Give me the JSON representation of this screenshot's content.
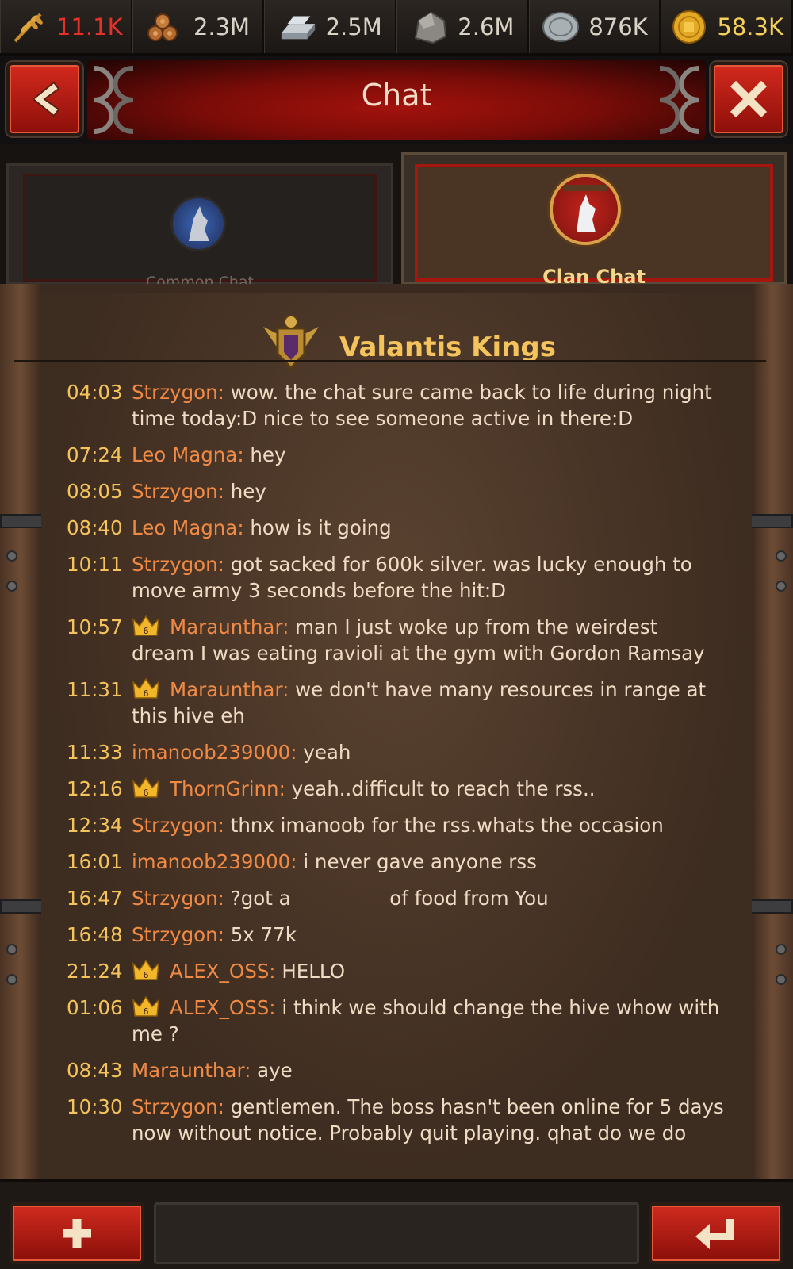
{
  "resources": [
    {
      "name": "food",
      "value": "11.1K",
      "icon": "wheat-icon",
      "color": "#e8302a"
    },
    {
      "name": "wood",
      "value": "2.3M",
      "icon": "logs-icon",
      "color": "#d9d2c6"
    },
    {
      "name": "iron",
      "value": "2.5M",
      "icon": "iron-ingot-icon",
      "color": "#d9d2c6"
    },
    {
      "name": "stone",
      "value": "2.6M",
      "icon": "stone-icon",
      "color": "#d9d2c6"
    },
    {
      "name": "silver",
      "value": "876K",
      "icon": "silver-coin-icon",
      "color": "#d9d2c6"
    },
    {
      "name": "gold",
      "value": "58.3K",
      "icon": "gold-coin-icon",
      "color": "#f5d05a"
    }
  ],
  "header": {
    "title": "Chat"
  },
  "tabs": {
    "common": "Common Chat",
    "clan": "Clan Chat"
  },
  "clan": {
    "name": "Valantis Kings"
  },
  "messages": [
    {
      "time": "04:03",
      "author": "Strzygon:",
      "crown": false,
      "text": "wow. the chat sure came back to life during night time today:D nice to see someone active in there:D"
    },
    {
      "time": "07:24",
      "author": "Leo Magna:",
      "crown": false,
      "text": "hey"
    },
    {
      "time": "08:05",
      "author": "Strzygon:",
      "crown": false,
      "text": "hey"
    },
    {
      "time": "08:40",
      "author": "Leo Magna:",
      "crown": false,
      "text": "how is it going"
    },
    {
      "time": "10:11",
      "author": "Strzygon:",
      "crown": false,
      "text": "got sacked for 600k silver. was lucky enough to move army 3 seconds before the hit:D"
    },
    {
      "time": "10:57",
      "author": "Maraunthar:",
      "crown": true,
      "text": "man I just woke up from the weirdest dream I was eating ravioli at the gym with Gordon Ramsay"
    },
    {
      "time": "11:31",
      "author": "Maraunthar:",
      "crown": true,
      "text": "we don't have many resources in range at this hive eh"
    },
    {
      "time": "11:33",
      "author": "imanoob239000:",
      "crown": false,
      "text": "yeah"
    },
    {
      "time": "12:16",
      "author": "ThornGrinn:",
      "crown": true,
      "text": "yeah..difficult to reach the rss.."
    },
    {
      "time": "12:34",
      "author": "Strzygon:",
      "crown": false,
      "text": "thnx imanoob for the rss.whats the occasion"
    },
    {
      "time": "16:01",
      "author": "imanoob239000:",
      "crown": false,
      "text": "i never gave anyone rss"
    },
    {
      "time": "16:47",
      "author": "Strzygon:",
      "crown": false,
      "text": "?got a                of food from You"
    },
    {
      "time": "16:48",
      "author": "Strzygon:",
      "crown": false,
      "text": "5x 77k"
    },
    {
      "time": "21:24",
      "author": "ALEX_OSS:",
      "crown": true,
      "text": "HELLO"
    },
    {
      "time": "01:06",
      "author": "ALEX_OSS:",
      "crown": true,
      "text": "i think we should change the hive whow with me ?"
    },
    {
      "time": "08:43",
      "author": "Maraunthar:",
      "crown": false,
      "text": "aye"
    },
    {
      "time": "10:30",
      "author": "Strzygon:",
      "crown": false,
      "text": "gentlemen. The boss hasn't been online for 5 days now without notice. Probably quit playing. qhat do we do"
    }
  ],
  "crown_level": "6"
}
